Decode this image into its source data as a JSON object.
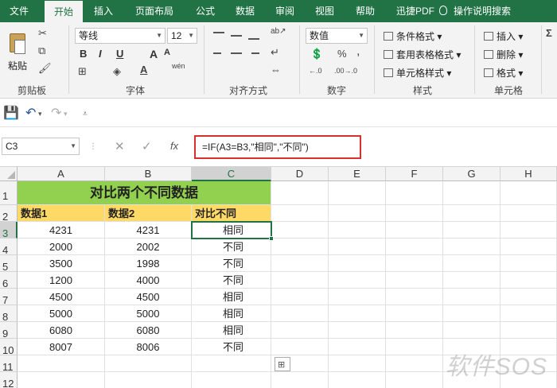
{
  "ribbon_tabs": [
    "文件",
    "开始",
    "插入",
    "页面布局",
    "公式",
    "数据",
    "审阅",
    "视图",
    "帮助",
    "迅捷PDF"
  ],
  "search_label": "操作说明搜索",
  "clipboard": {
    "paste_label": "粘贴",
    "group_label": "剪贴板"
  },
  "font": {
    "name": "等线",
    "size": "12",
    "group_label": "字体",
    "bold": "B",
    "italic": "I",
    "underline": "U",
    "phonetic": "wén",
    "font_grow": "A",
    "font_shrink": "A"
  },
  "alignment": {
    "group_label": "对齐方式"
  },
  "number": {
    "format": "数值",
    "group_label": "数字",
    "percent": "%",
    "comma": ",",
    "inc_decimal": "←.0",
    "dec_decimal": ".00→.0"
  },
  "styles": {
    "conditional": "条件格式",
    "table": "套用表格格式",
    "cell_styles": "单元格样式",
    "group_label": "样式"
  },
  "cells": {
    "insert": "插入",
    "delete": "删除",
    "format": "格式",
    "group_label": "单元格"
  },
  "formula_bar": {
    "name_box": "C3",
    "cancel": "✕",
    "enter": "✓",
    "fx": "fx",
    "formula": "=IF(A3=B3,\"相同\",\"不同\")"
  },
  "columns": [
    "A",
    "B",
    "C",
    "D",
    "E",
    "F",
    "G",
    "H"
  ],
  "rows": [
    "1",
    "2",
    "3",
    "4",
    "5",
    "6",
    "7",
    "8",
    "9",
    "10",
    "11",
    "12"
  ],
  "sheet": {
    "title": "对比两个不同数据",
    "headers": [
      "数据1",
      "数据2",
      "对比不同"
    ],
    "data": [
      [
        "4231",
        "4231",
        "相同"
      ],
      [
        "2000",
        "2002",
        "不同"
      ],
      [
        "3500",
        "1998",
        "不同"
      ],
      [
        "1200",
        "4000",
        "不同"
      ],
      [
        "4500",
        "4500",
        "相同"
      ],
      [
        "5000",
        "5000",
        "相同"
      ],
      [
        "6080",
        "6080",
        "相同"
      ],
      [
        "8007",
        "8006",
        "不同"
      ]
    ]
  },
  "colors": {
    "title_fill": "#92d050",
    "header_fill": "#ffd966",
    "ribbon": "#217346",
    "highlight": "#d9302d"
  },
  "watermark": "软件SOS"
}
